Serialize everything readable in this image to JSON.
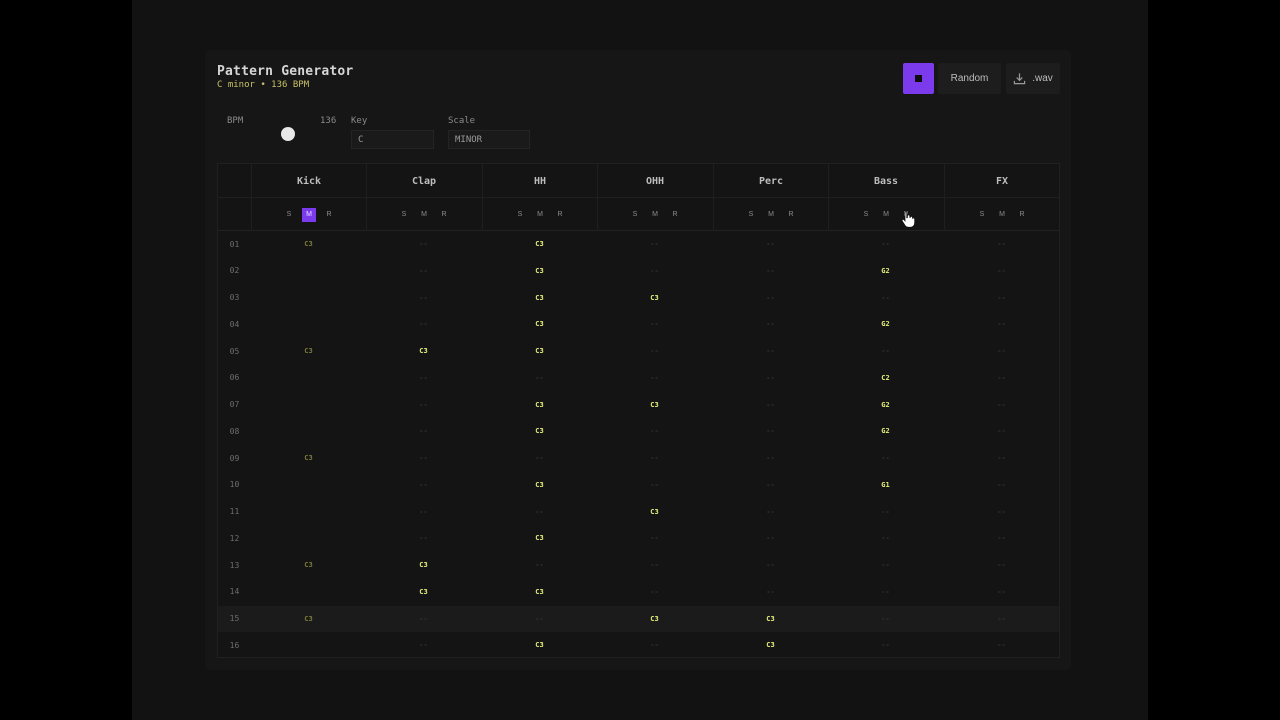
{
  "header": {
    "title": "Pattern Generator",
    "subtitle": "C minor • 136 BPM"
  },
  "toolbar": {
    "stop_icon": "stop-icon",
    "random_label": "Random",
    "wav_label": ".wav"
  },
  "controls": {
    "bpm_label": "BPM",
    "bpm_value": "136",
    "key_label": "Key",
    "key_value": "C",
    "scale_label": "Scale",
    "scale_value": "MINOR"
  },
  "tracks": [
    {
      "name": "Kick",
      "s": "S",
      "m": "M",
      "r": "R",
      "muted": true
    },
    {
      "name": "Clap",
      "s": "S",
      "m": "M",
      "r": "R"
    },
    {
      "name": "HH",
      "s": "S",
      "m": "M",
      "r": "R"
    },
    {
      "name": "OHH",
      "s": "S",
      "m": "M",
      "r": "R"
    },
    {
      "name": "Perc",
      "s": "S",
      "m": "M",
      "r": "R"
    },
    {
      "name": "Bass",
      "s": "S",
      "m": "M",
      "r": "R"
    },
    {
      "name": "FX",
      "s": "S",
      "m": "M",
      "r": "R"
    }
  ],
  "steps": [
    {
      "n": "01",
      "cells": [
        "C3",
        "--",
        "C3",
        "--",
        "--",
        "--",
        "--"
      ]
    },
    {
      "n": "02",
      "cells": [
        "",
        "--",
        "C3",
        "--",
        "--",
        "G2",
        "--"
      ]
    },
    {
      "n": "03",
      "cells": [
        "",
        "--",
        "C3",
        "C3",
        "--",
        "--",
        "--"
      ]
    },
    {
      "n": "04",
      "cells": [
        "",
        "--",
        "C3",
        "--",
        "--",
        "G2",
        "--"
      ]
    },
    {
      "n": "05",
      "cells": [
        "C3",
        "C3",
        "C3",
        "--",
        "--",
        "--",
        "--"
      ]
    },
    {
      "n": "06",
      "cells": [
        "",
        "--",
        "--",
        "--",
        "--",
        "C2",
        "--"
      ]
    },
    {
      "n": "07",
      "cells": [
        "",
        "--",
        "C3",
        "C3",
        "--",
        "G2",
        "--"
      ]
    },
    {
      "n": "08",
      "cells": [
        "",
        "--",
        "C3",
        "--",
        "--",
        "G2",
        "--"
      ]
    },
    {
      "n": "09",
      "cells": [
        "C3",
        "--",
        "--",
        "--",
        "--",
        "--",
        "--"
      ]
    },
    {
      "n": "10",
      "cells": [
        "",
        "--",
        "C3",
        "--",
        "--",
        "G1",
        "--"
      ]
    },
    {
      "n": "11",
      "cells": [
        "",
        "--",
        "--",
        "C3",
        "--",
        "--",
        "--"
      ]
    },
    {
      "n": "12",
      "cells": [
        "",
        "--",
        "C3",
        "--",
        "--",
        "--",
        "--"
      ]
    },
    {
      "n": "13",
      "cells": [
        "C3",
        "C3",
        "--",
        "--",
        "--",
        "--",
        "--"
      ]
    },
    {
      "n": "14",
      "cells": [
        "",
        "C3",
        "C3",
        "--",
        "--",
        "--",
        "--"
      ]
    },
    {
      "n": "15",
      "cells": [
        "C3",
        "--",
        "--",
        "C3",
        "C3",
        "--",
        "--"
      ],
      "highlight": true
    },
    {
      "n": "16",
      "cells": [
        "",
        "--",
        "C3",
        "--",
        "C3",
        "--",
        "--"
      ]
    }
  ]
}
